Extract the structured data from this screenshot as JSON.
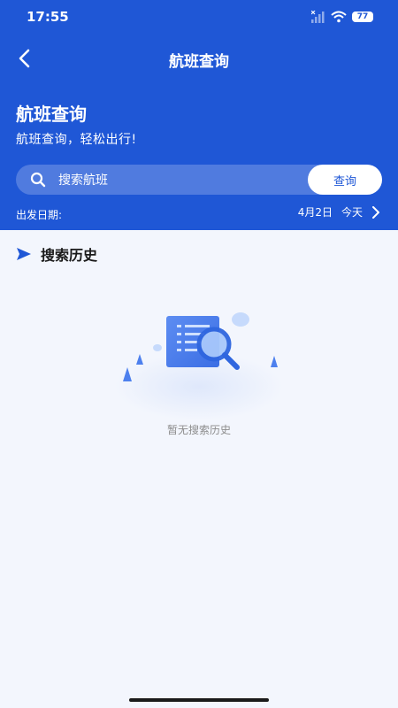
{
  "status_bar": {
    "time": "17:55",
    "battery": "77"
  },
  "navbar": {
    "title": "航班查询"
  },
  "hero": {
    "title": "航班查询",
    "subtitle": "航班查询，轻松出行!"
  },
  "search": {
    "placeholder": "搜索航班",
    "button_label": "查询"
  },
  "date": {
    "label": "出发日期:",
    "value": "4月2日",
    "relative": "今天"
  },
  "history": {
    "title": "搜索历史",
    "empty_text": "暂无搜索历史"
  },
  "colors": {
    "primary": "#1f57d6",
    "background": "#f3f6fd"
  }
}
